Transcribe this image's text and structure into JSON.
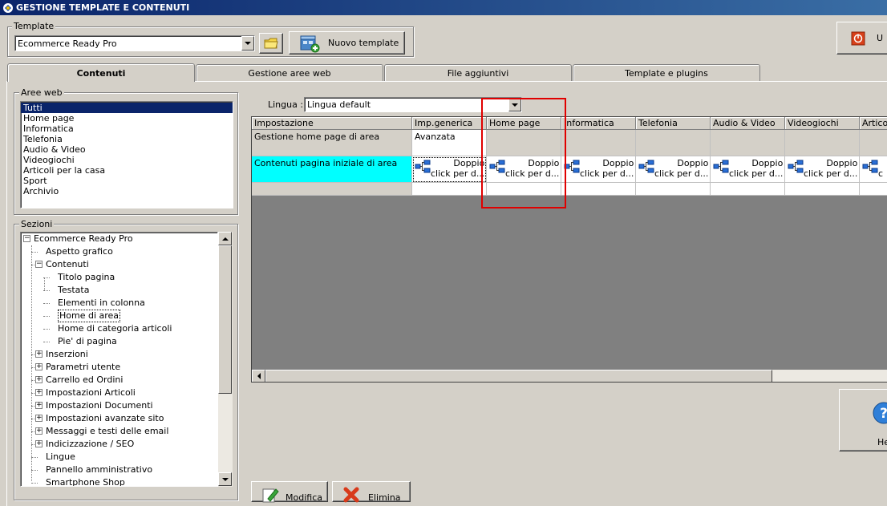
{
  "window": {
    "title": "GESTIONE TEMPLATE E CONTENUTI"
  },
  "template_group": {
    "label": "Template",
    "selected": "Ecommerce Ready Pro",
    "new_button": "Nuovo template"
  },
  "corner_buttons": {
    "top_right_label": "U",
    "help_label": "He"
  },
  "tabs": [
    {
      "label": "Contenuti",
      "active": true
    },
    {
      "label": "Gestione aree web",
      "active": false
    },
    {
      "label": "File aggiuntivi",
      "active": false
    },
    {
      "label": "Template e plugins",
      "active": false
    }
  ],
  "aree_web": {
    "label": "Aree web",
    "items": [
      "Tutti",
      "Home page",
      "Informatica",
      "Telefonia",
      "Audio & Video",
      "Videogiochi",
      "Articoli per la casa",
      "Sport",
      "Archivio"
    ],
    "selected_index": 0
  },
  "sezioni": {
    "label": "Sezioni",
    "tree": [
      {
        "label": "Ecommerce Ready Pro",
        "level": 0,
        "expander": "−"
      },
      {
        "label": "Aspetto grafico",
        "level": 1,
        "expander": ""
      },
      {
        "label": "Contenuti",
        "level": 1,
        "expander": "−"
      },
      {
        "label": "Titolo pagina",
        "level": 2,
        "expander": ""
      },
      {
        "label": "Testata",
        "level": 2,
        "expander": ""
      },
      {
        "label": "Elementi in colonna",
        "level": 2,
        "expander": ""
      },
      {
        "label": "Home di area",
        "level": 2,
        "expander": "",
        "selected": true
      },
      {
        "label": "Home di categoria articoli",
        "level": 2,
        "expander": ""
      },
      {
        "label": "Pie' di pagina",
        "level": 2,
        "expander": ""
      },
      {
        "label": "Inserzioni",
        "level": 1,
        "expander": "+"
      },
      {
        "label": "Parametri utente",
        "level": 1,
        "expander": "+"
      },
      {
        "label": "Carrello ed Ordini",
        "level": 1,
        "expander": "+"
      },
      {
        "label": "Impostazioni Articoli",
        "level": 1,
        "expander": "+"
      },
      {
        "label": "Impostazioni Documenti",
        "level": 1,
        "expander": "+"
      },
      {
        "label": "Impostazioni avanzate sito",
        "level": 1,
        "expander": "+"
      },
      {
        "label": "Messaggi e testi delle email",
        "level": 1,
        "expander": "+"
      },
      {
        "label": "Indicizzazione / SEO",
        "level": 1,
        "expander": "+"
      },
      {
        "label": "Lingue",
        "level": 1,
        "expander": ""
      },
      {
        "label": "Pannello amministrativo",
        "level": 1,
        "expander": ""
      },
      {
        "label": "Smartphone Shop",
        "level": 1,
        "expander": ""
      }
    ]
  },
  "lingua": {
    "label": "Lingua :",
    "selected": "Lingua default"
  },
  "grid": {
    "headers": [
      "Impostazione",
      "Imp.generica",
      "Home page",
      "Informatica",
      "Telefonia",
      "Audio & Video",
      "Videogiochi",
      "Articoli"
    ],
    "row1": {
      "setting": "Gestione home page di area",
      "generic": "Avanzata"
    },
    "row2": {
      "setting": "Contenuti pagina iniziale di area",
      "cell_line1": "Doppio",
      "cell_line2": "click per d...",
      "last_line2": "c"
    }
  },
  "bottom_buttons": {
    "modify": "Modifica",
    "delete": "Elimina"
  },
  "colors": {
    "selection": "#0a246a",
    "highlight_cell": "#00ffff",
    "red_box": "#e00000",
    "grid_empty": "#808080"
  }
}
